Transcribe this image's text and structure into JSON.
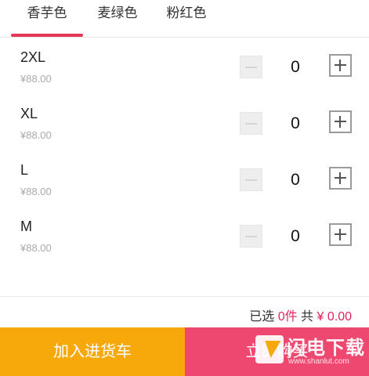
{
  "tabs": [
    {
      "label": "香芋色"
    },
    {
      "label": "麦绿色"
    },
    {
      "label": "粉红色"
    }
  ],
  "variants": [
    {
      "size": "2XL",
      "price": "¥88.00",
      "quantity": "0"
    },
    {
      "size": "XL",
      "price": "¥88.00",
      "quantity": "0"
    },
    {
      "size": "L",
      "price": "¥88.00",
      "quantity": "0"
    },
    {
      "size": "M",
      "price": "¥88.00",
      "quantity": "0"
    }
  ],
  "summary": {
    "selected_label": "已选",
    "selected_count": "0件",
    "total_label": "共",
    "total_amount": "¥ 0.00"
  },
  "actions": {
    "add_to_cart": "加入进货车",
    "buy_now": "立即购买"
  },
  "watermark": {
    "title": "闪电下载",
    "subtitle": "www.shanlut.com"
  },
  "colors": {
    "accent_red": "#e53958",
    "cart_orange": "#f7a90c",
    "buy_pink": "#ee4770"
  }
}
